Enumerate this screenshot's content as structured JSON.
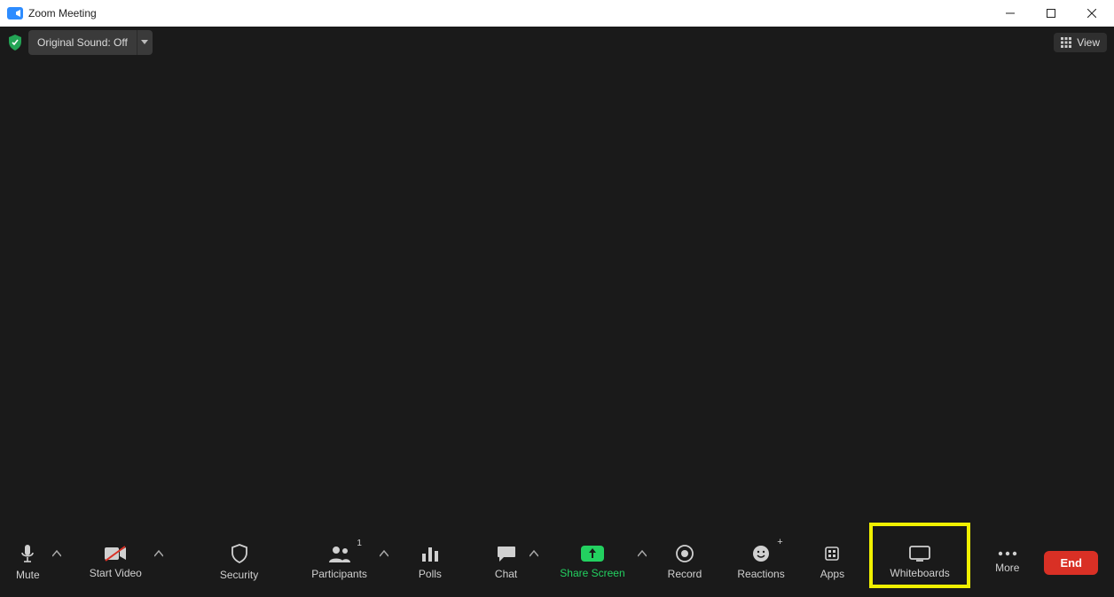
{
  "window": {
    "title": "Zoom Meeting"
  },
  "topbar": {
    "original_sound_label": "Original Sound: Off",
    "view_label": "View"
  },
  "toolbar": {
    "mute": "Mute",
    "start_video": "Start Video",
    "security": "Security",
    "participants": "Participants",
    "participants_count": "1",
    "polls": "Polls",
    "chat": "Chat",
    "share_screen": "Share Screen",
    "record": "Record",
    "reactions": "Reactions",
    "apps": "Apps",
    "whiteboards": "Whiteboards",
    "more": "More",
    "end": "End"
  },
  "highlight": {
    "target": "whiteboards-button"
  }
}
